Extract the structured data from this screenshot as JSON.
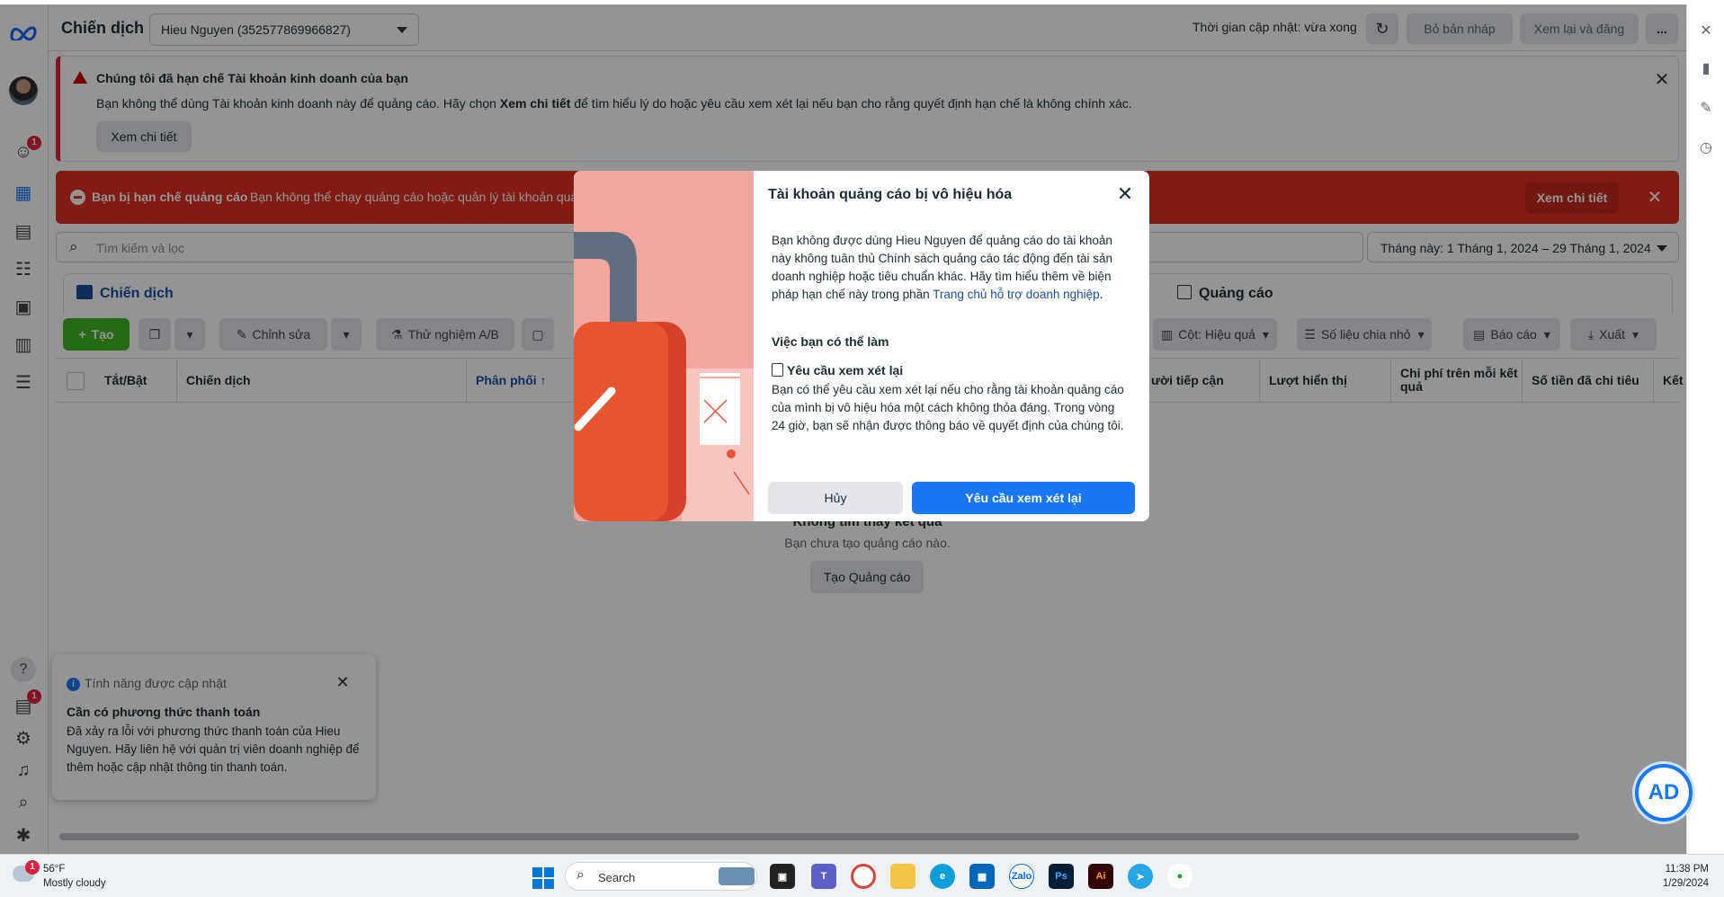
{
  "header": {
    "title": "Chiến dịch",
    "account": "Hieu Nguyen (352577869966827)",
    "update_time": "Thời gian cập nhật: vừa xong",
    "discard_drafts": "Bỏ bản nháp",
    "review_publish": "Xem lại và đăng",
    "more": "..."
  },
  "business_warning": {
    "title": "Chúng tôi đã hạn chế Tài khoản kinh doanh của bạn",
    "text_before": "Bạn không thể dùng Tài khoản kinh doanh này để quảng cáo. Hãy chọn ",
    "text_bold": "Xem chi tiết",
    "text_after": " để tìm hiểu lý do hoặc yêu cầu xem xét lại nếu bạn cho rằng quyết định hạn chế là không chính xác.",
    "button": "Xem chi tiết"
  },
  "restriction_banner": {
    "title": "Bạn bị hạn chế quảng cáo",
    "text": "Bạn không thể chạy quảng cáo hoặc quản lý tài khoản quả",
    "button": "Xem chi tiết"
  },
  "search": {
    "placeholder": "Tìm kiếm và lọc"
  },
  "date_range": "Tháng này: 1 Tháng 1, 2024 – 29 Tháng 1, 2024",
  "tabs": {
    "campaigns": "Chiến dịch",
    "ads": "Quảng cáo"
  },
  "toolbar": {
    "create": "Tạo",
    "edit": "Chỉnh sửa",
    "ab_test": "Thử nghiệm A/B",
    "columns": "Cột: Hiệu quả",
    "breakdown": "Số liệu chia nhỏ",
    "reports": "Báo cáo",
    "export": "Xuất"
  },
  "table_headers": {
    "toggle": "Tắt/Bật",
    "campaign": "Chiến dịch",
    "delivery": "Phân phối ↑",
    "reach": "ười tiếp cận",
    "impressions": "Lượt hiển thị",
    "cost_per_result": "Chi phí trên mỗi kết quả",
    "amount_spent": "Số tiền đã chi tiêu",
    "results": "Kết"
  },
  "empty_state": {
    "title": "Không tìm thấy kết quả",
    "text": "Bạn chưa tạo quảng cáo nào.",
    "button": "Tạo Quảng cáo"
  },
  "notice": {
    "label": "Tính năng được cập nhật",
    "title": "Cần có phương thức thanh toán",
    "text": "Đã xảy ra lỗi với phương thức thanh toán của Hieu Nguyen. Hãy liên hệ với quản trị viên doanh nghiệp để thêm hoặc cập nhật thông tin thanh toán."
  },
  "modal": {
    "title": "Tài khoản quảng cáo bị vô hiệu hóa",
    "desc": "Bạn không được dùng Hieu Nguyen để quảng cáo do tài khoản này không tuân thủ Chính sách quảng cáo tác động đến tài sản doanh nghiệp hoặc tiêu chuẩn khác. Hãy tìm hiểu thêm về biện pháp hạn chế này trong phần ",
    "link": "Trang chủ hỗ trợ doanh nghiệp",
    "subtitle": "Việc bạn có thể làm",
    "option_title": "Yêu cầu xem xét lại",
    "option_text": "Bạn có thể yêu cầu xem xét lại nếu cho rằng tài khoản quảng cáo của mình bị vô hiệu hóa một cách không thỏa đáng. Trong vòng 24 giờ, bạn sẽ nhận được thông báo về quyết định của chúng tôi.",
    "cancel": "Hủy",
    "submit": "Yêu cầu xem xét lại"
  },
  "rail_badges": {
    "notifications": "1",
    "messages": "1"
  },
  "taskbar": {
    "temp": "56°F",
    "weather": "Mostly cloudy",
    "search": "Search",
    "time": "11:38 PM",
    "date": "1/29/2024",
    "weather_badge": "1"
  },
  "colors": {
    "brand_blue": "#1877f2",
    "danger_red": "#e12f20",
    "create_green": "#42b72a"
  },
  "icons": [
    "meta-logo-icon",
    "search-icon",
    "refresh-icon",
    "close-icon",
    "lock-icon",
    "windows-start-icon",
    "info-icon"
  ]
}
